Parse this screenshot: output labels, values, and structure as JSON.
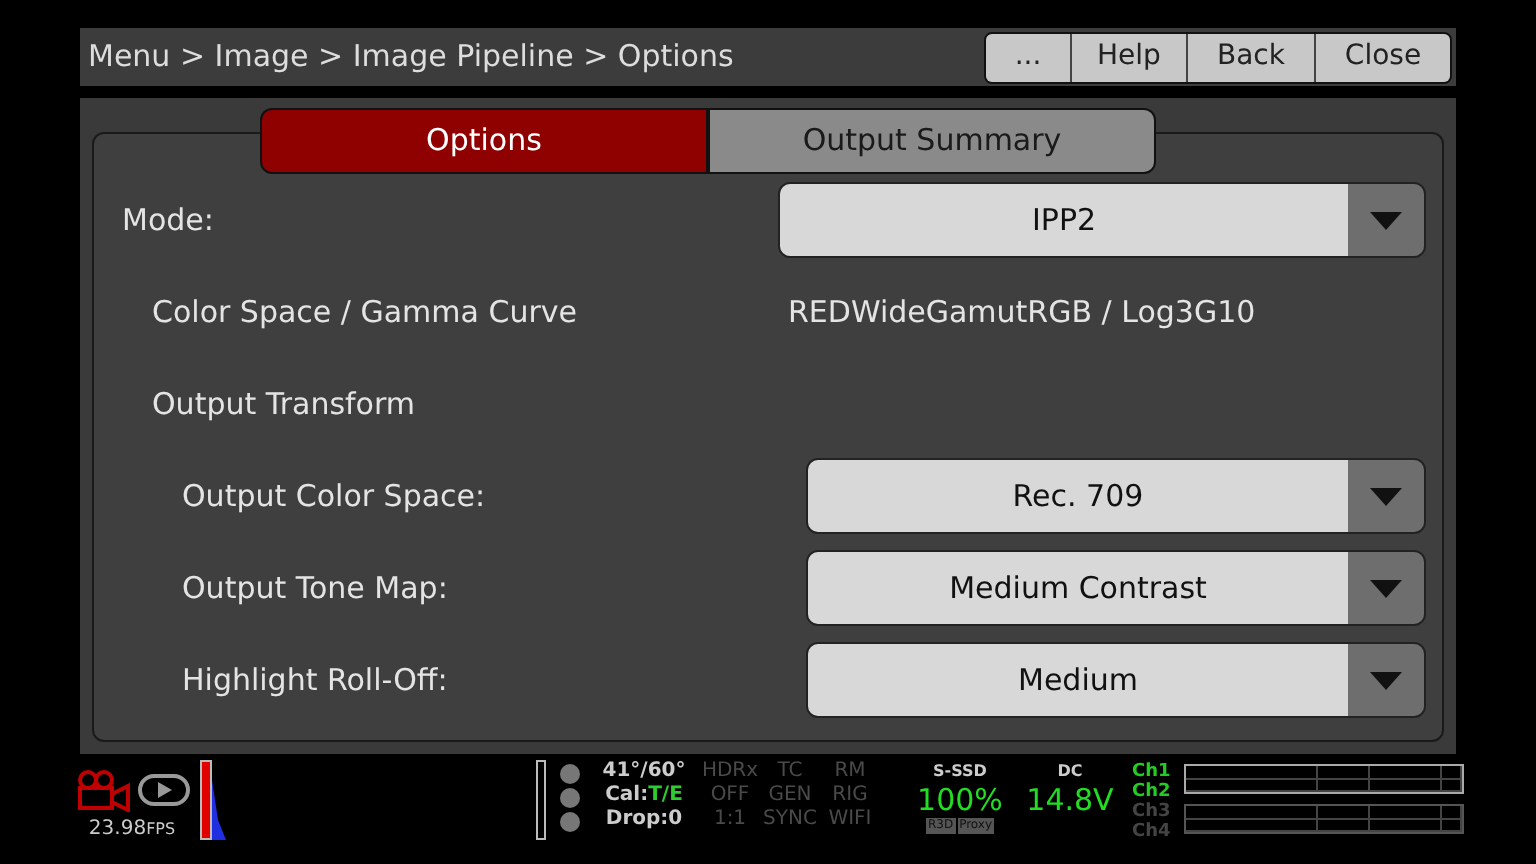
{
  "header": {
    "breadcrumb": "Menu > Image > Image Pipeline > Options",
    "buttons": [
      "...",
      "Help",
      "Back",
      "Close"
    ]
  },
  "tabs": [
    {
      "label": "Options",
      "selected": true
    },
    {
      "label": "Output Summary",
      "selected": false
    }
  ],
  "rows": [
    {
      "kind": "dropdown",
      "label": "Mode:",
      "value": "IPP2"
    },
    {
      "kind": "info",
      "label": "Color Space / Gamma Curve",
      "value": "REDWideGamutRGB / Log3G10"
    },
    {
      "kind": "heading",
      "label": "Output Transform",
      "children": [
        {
          "kind": "dropdown",
          "label": "Output Color Space:",
          "value": "Rec. 709"
        },
        {
          "kind": "dropdown",
          "label": "Output Tone Map:",
          "value": "Medium Contrast"
        },
        {
          "kind": "dropdown",
          "label": "Highlight Roll-Off:",
          "value": "Medium"
        }
      ]
    }
  ],
  "status_bar": {
    "fps": "23.98",
    "fps_unit": "FPS",
    "temp": "41°/60°",
    "cal_label": "Cal:",
    "cal_value": "T/E",
    "drop": "Drop:0",
    "columns": [
      [
        "HDRx",
        "OFF",
        "1:1"
      ],
      [
        "TC",
        "GEN",
        "SYNC"
      ],
      [
        "RM",
        "RIG",
        "WIFI"
      ]
    ],
    "media": {
      "label": "S-SSD",
      "value": "100%",
      "tags": [
        "R3D",
        "Proxy"
      ]
    },
    "power": {
      "label": "DC",
      "value": "14.8V"
    },
    "channels": [
      {
        "label": "Ch1",
        "on": true
      },
      {
        "label": "Ch2",
        "on": true
      },
      {
        "label": "Ch3",
        "on": false
      },
      {
        "label": "Ch4",
        "on": false
      }
    ]
  }
}
